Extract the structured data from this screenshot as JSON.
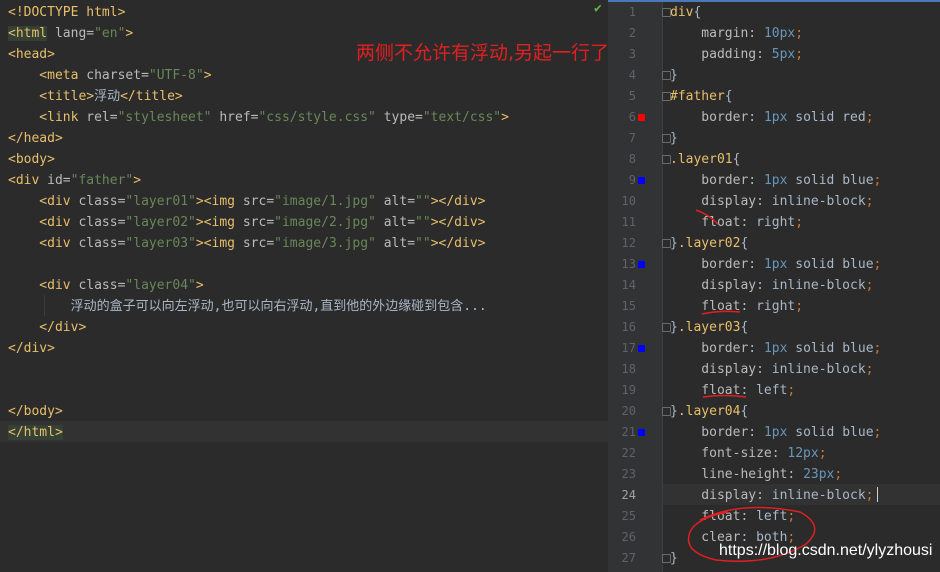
{
  "html_editor": {
    "lines": [
      [
        {
          "t": "<!DOCTYPE html>",
          "c": "tag"
        }
      ],
      [
        {
          "t": "<html",
          "c": "tag hl"
        },
        {
          "t": " lang=",
          "c": "attr"
        },
        {
          "t": "\"en\"",
          "c": "val"
        },
        {
          "t": ">",
          "c": "tag"
        }
      ],
      [
        {
          "t": "<head>",
          "c": "tag"
        }
      ],
      [
        {
          "t": "    <meta",
          "c": "tag"
        },
        {
          "t": " charset=",
          "c": "attr"
        },
        {
          "t": "\"UTF-8\"",
          "c": "val"
        },
        {
          "t": ">",
          "c": "tag"
        }
      ],
      [
        {
          "t": "    <title>",
          "c": "tag"
        },
        {
          "t": "浮动",
          "c": "txt"
        },
        {
          "t": "</title>",
          "c": "tag"
        }
      ],
      [
        {
          "t": "    <link",
          "c": "tag"
        },
        {
          "t": " rel=",
          "c": "attr"
        },
        {
          "t": "\"stylesheet\"",
          "c": "val"
        },
        {
          "t": " href=",
          "c": "attr"
        },
        {
          "t": "\"css/style.css\"",
          "c": "val"
        },
        {
          "t": " type=",
          "c": "attr"
        },
        {
          "t": "\"text/css\"",
          "c": "val"
        },
        {
          "t": ">",
          "c": "tag"
        }
      ],
      [
        {
          "t": "</head>",
          "c": "tag"
        }
      ],
      [
        {
          "t": "<body>",
          "c": "tag"
        }
      ],
      [
        {
          "t": "<div",
          "c": "tag"
        },
        {
          "t": " id=",
          "c": "attr"
        },
        {
          "t": "\"father\"",
          "c": "val"
        },
        {
          "t": ">",
          "c": "tag"
        }
      ],
      [
        {
          "t": "    <div",
          "c": "tag"
        },
        {
          "t": " class=",
          "c": "attr"
        },
        {
          "t": "\"layer01\"",
          "c": "val"
        },
        {
          "t": "><img",
          "c": "tag"
        },
        {
          "t": " src=",
          "c": "attr"
        },
        {
          "t": "\"image/1.jpg\"",
          "c": "val"
        },
        {
          "t": " alt=",
          "c": "attr"
        },
        {
          "t": "\"\"",
          "c": "val"
        },
        {
          "t": "></div>",
          "c": "tag"
        }
      ],
      [
        {
          "t": "    <div",
          "c": "tag"
        },
        {
          "t": " class=",
          "c": "attr"
        },
        {
          "t": "\"layer02\"",
          "c": "val"
        },
        {
          "t": "><img",
          "c": "tag"
        },
        {
          "t": " src=",
          "c": "attr"
        },
        {
          "t": "\"image/2.jpg\"",
          "c": "val"
        },
        {
          "t": " alt=",
          "c": "attr"
        },
        {
          "t": "\"\"",
          "c": "val"
        },
        {
          "t": "></div>",
          "c": "tag"
        }
      ],
      [
        {
          "t": "    <div",
          "c": "tag"
        },
        {
          "t": " class=",
          "c": "attr"
        },
        {
          "t": "\"layer03\"",
          "c": "val"
        },
        {
          "t": "><img",
          "c": "tag"
        },
        {
          "t": " src=",
          "c": "attr"
        },
        {
          "t": "\"image/3.jpg\"",
          "c": "val"
        },
        {
          "t": " alt=",
          "c": "attr"
        },
        {
          "t": "\"\"",
          "c": "val"
        },
        {
          "t": "></div>",
          "c": "tag"
        }
      ],
      [],
      [
        {
          "t": "    <div",
          "c": "tag"
        },
        {
          "t": " class=",
          "c": "attr"
        },
        {
          "t": "\"layer04\"",
          "c": "val"
        },
        {
          "t": ">",
          "c": "tag"
        }
      ],
      [
        {
          "t": "        浮动的盒子可以向左浮动,也可以向右浮动,直到他的外边缘碰到包含...",
          "c": "txt"
        }
      ],
      [
        {
          "t": "    </div>",
          "c": "tag"
        }
      ],
      [
        {
          "t": "</div>",
          "c": "tag"
        }
      ],
      [],
      [],
      [
        {
          "t": "</body>",
          "c": "tag"
        }
      ],
      [
        {
          "t": "</html>",
          "c": "tag hl"
        }
      ]
    ]
  },
  "css_editor": {
    "line_numbers": [
      "1",
      "2",
      "3",
      "4",
      "5",
      "6",
      "7",
      "8",
      "9",
      "10",
      "11",
      "12",
      "13",
      "14",
      "15",
      "16",
      "17",
      "18",
      "19",
      "20",
      "21",
      "22",
      "23",
      "24",
      "25",
      "26",
      "27"
    ],
    "current_line": "24",
    "lines": [
      [
        {
          "t": "div",
          "c": "sel"
        },
        {
          "t": "{",
          "c": "kw"
        }
      ],
      [
        {
          "t": "    margin",
          "c": "prop"
        },
        {
          "t": ": ",
          "c": "kw"
        },
        {
          "t": "10px",
          "c": "num"
        },
        {
          "t": ";",
          "c": "punc"
        }
      ],
      [
        {
          "t": "    padding",
          "c": "prop"
        },
        {
          "t": ": ",
          "c": "kw"
        },
        {
          "t": "5px",
          "c": "num"
        },
        {
          "t": ";",
          "c": "punc"
        }
      ],
      [
        {
          "t": "}",
          "c": "kw"
        }
      ],
      [
        {
          "t": "#father",
          "c": "sel"
        },
        {
          "t": "{",
          "c": "kw"
        }
      ],
      [
        {
          "t": "    border",
          "c": "prop"
        },
        {
          "t": ": ",
          "c": "kw"
        },
        {
          "t": "1px",
          "c": "num"
        },
        {
          "t": " solid red",
          "c": "kw"
        },
        {
          "t": ";",
          "c": "punc"
        }
      ],
      [
        {
          "t": "}",
          "c": "kw"
        }
      ],
      [
        {
          "t": ".layer01",
          "c": "sel"
        },
        {
          "t": "{",
          "c": "kw"
        }
      ],
      [
        {
          "t": "    border",
          "c": "prop"
        },
        {
          "t": ": ",
          "c": "kw"
        },
        {
          "t": "1px",
          "c": "num"
        },
        {
          "t": " solid blue",
          "c": "kw"
        },
        {
          "t": ";",
          "c": "punc"
        }
      ],
      [
        {
          "t": "    display",
          "c": "prop"
        },
        {
          "t": ": inline-block",
          "c": "kw"
        },
        {
          "t": ";",
          "c": "punc"
        }
      ],
      [
        {
          "t": "    float",
          "c": "prop"
        },
        {
          "t": ": right",
          "c": "kw"
        },
        {
          "t": ";",
          "c": "punc"
        }
      ],
      [
        {
          "t": "}",
          "c": "kw"
        },
        {
          "t": ".layer02",
          "c": "sel"
        },
        {
          "t": "{",
          "c": "kw"
        }
      ],
      [
        {
          "t": "    border",
          "c": "prop"
        },
        {
          "t": ": ",
          "c": "kw"
        },
        {
          "t": "1px",
          "c": "num"
        },
        {
          "t": " solid blue",
          "c": "kw"
        },
        {
          "t": ";",
          "c": "punc"
        }
      ],
      [
        {
          "t": "    display",
          "c": "prop"
        },
        {
          "t": ": inline-block",
          "c": "kw"
        },
        {
          "t": ";",
          "c": "punc"
        }
      ],
      [
        {
          "t": "    float",
          "c": "prop"
        },
        {
          "t": ": right",
          "c": "kw"
        },
        {
          "t": ";",
          "c": "punc"
        }
      ],
      [
        {
          "t": "}",
          "c": "kw"
        },
        {
          "t": ".layer03",
          "c": "sel"
        },
        {
          "t": "{",
          "c": "kw"
        }
      ],
      [
        {
          "t": "    border",
          "c": "prop"
        },
        {
          "t": ": ",
          "c": "kw"
        },
        {
          "t": "1px",
          "c": "num"
        },
        {
          "t": " solid blue",
          "c": "kw"
        },
        {
          "t": ";",
          "c": "punc"
        }
      ],
      [
        {
          "t": "    display",
          "c": "prop"
        },
        {
          "t": ": inline-block",
          "c": "kw"
        },
        {
          "t": ";",
          "c": "punc"
        }
      ],
      [
        {
          "t": "    float",
          "c": "prop"
        },
        {
          "t": ": left",
          "c": "kw"
        },
        {
          "t": ";",
          "c": "punc"
        }
      ],
      [
        {
          "t": "}",
          "c": "kw"
        },
        {
          "t": ".layer04",
          "c": "sel"
        },
        {
          "t": "{",
          "c": "kw"
        }
      ],
      [
        {
          "t": "    border",
          "c": "prop"
        },
        {
          "t": ": ",
          "c": "kw"
        },
        {
          "t": "1px",
          "c": "num"
        },
        {
          "t": " solid blue",
          "c": "kw"
        },
        {
          "t": ";",
          "c": "punc"
        }
      ],
      [
        {
          "t": "    font-size",
          "c": "prop"
        },
        {
          "t": ": ",
          "c": "kw"
        },
        {
          "t": "12px",
          "c": "num"
        },
        {
          "t": ";",
          "c": "punc"
        }
      ],
      [
        {
          "t": "    line-height",
          "c": "prop"
        },
        {
          "t": ": ",
          "c": "kw"
        },
        {
          "t": "23px",
          "c": "num"
        },
        {
          "t": ";",
          "c": "punc"
        }
      ],
      [
        {
          "t": "    display",
          "c": "prop"
        },
        {
          "t": ": inline-block",
          "c": "kw"
        },
        {
          "t": ";",
          "c": "punc"
        }
      ],
      [
        {
          "t": "    float",
          "c": "prop"
        },
        {
          "t": ": left",
          "c": "kw"
        },
        {
          "t": ";",
          "c": "punc"
        }
      ],
      [
        {
          "t": "    clear",
          "c": "prop"
        },
        {
          "t": ": both",
          "c": "kw"
        },
        {
          "t": ";",
          "c": "punc"
        }
      ],
      [
        {
          "t": "}",
          "c": "kw"
        }
      ]
    ],
    "gutter_marks": [
      {
        "line": "6",
        "color": "#ff0000"
      },
      {
        "line": "9",
        "color": "#0000ff"
      },
      {
        "line": "13",
        "color": "#0000ff"
      },
      {
        "line": "17",
        "color": "#0000ff"
      },
      {
        "line": "21",
        "color": "#0000ff"
      }
    ]
  },
  "annotation": {
    "note": "两侧不允许有浮动,另起一行了",
    "ink_color": "#e02020"
  },
  "watermark": "https://blog.csdn.net/ylyzhousi"
}
